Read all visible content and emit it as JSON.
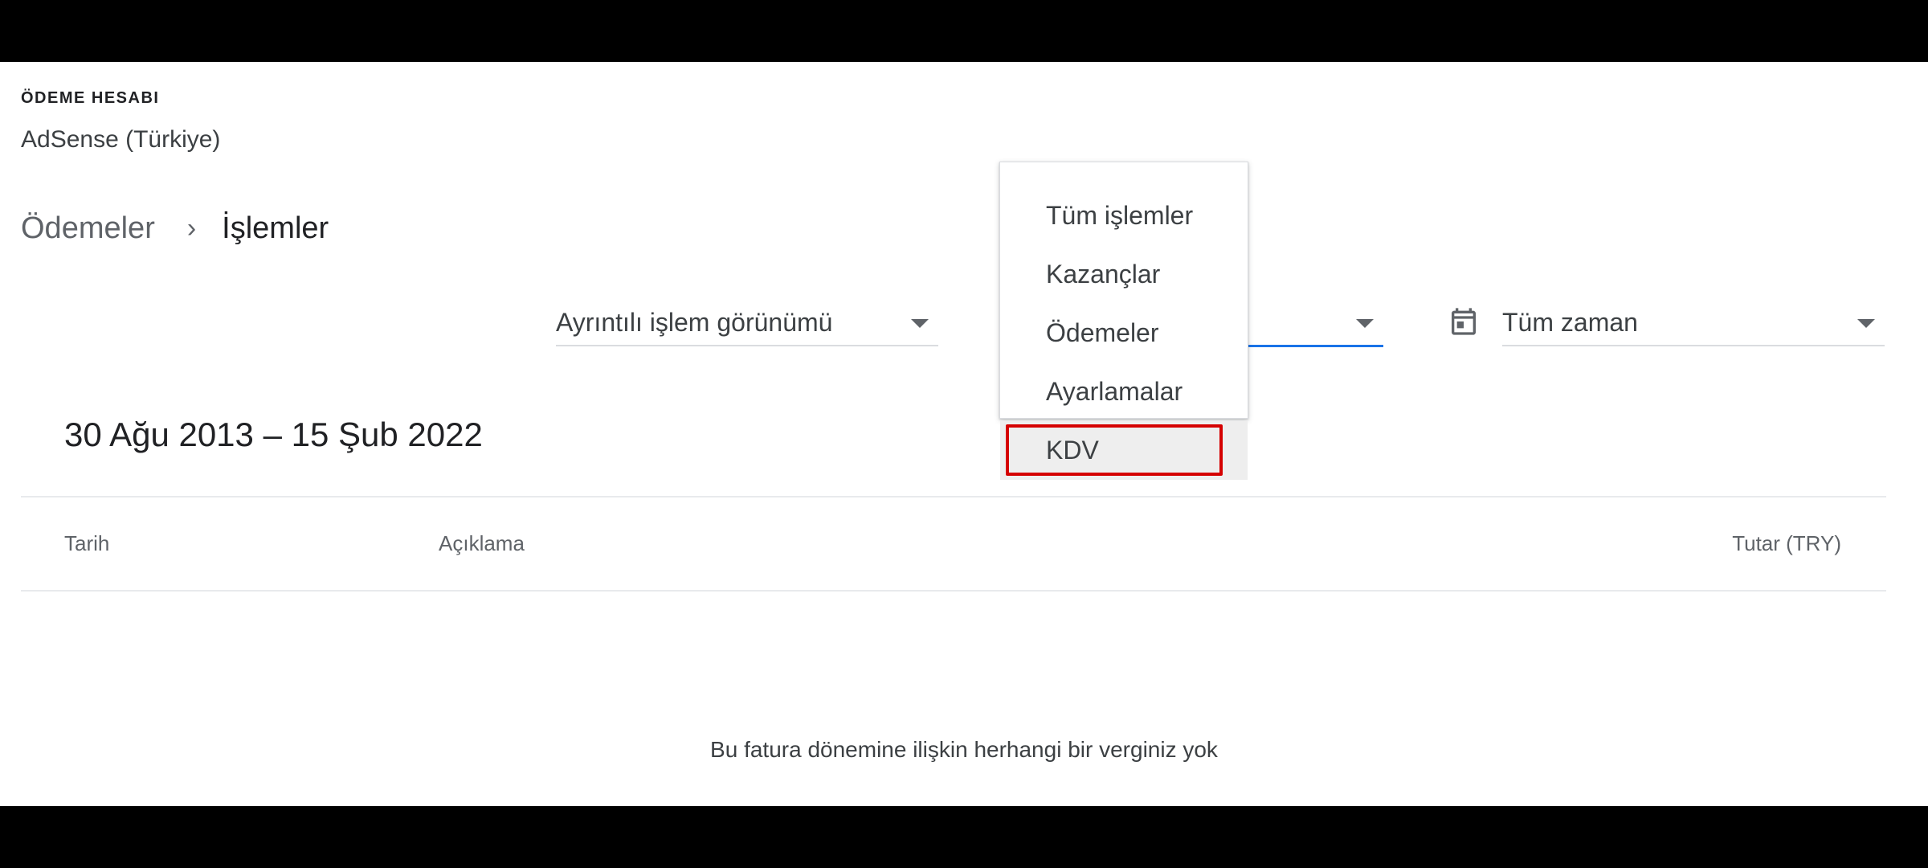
{
  "account": {
    "eyebrow": "ÖDEME HESABI",
    "name": "AdSense (Türkiye)"
  },
  "breadcrumb": {
    "parent": "Ödemeler",
    "separator": "›",
    "current": "İşlemler"
  },
  "filters": {
    "view": {
      "value": "Ayrıntılı işlem görünümü"
    },
    "time": {
      "value": "Tüm zaman",
      "icon": "calendar-icon"
    }
  },
  "dropdown": {
    "items": [
      {
        "label": "Tüm işlemler"
      },
      {
        "label": "Kazançlar"
      },
      {
        "label": "Ödemeler"
      },
      {
        "label": "Ayarlamalar"
      },
      {
        "label": "KDV"
      }
    ],
    "selected": "KDV",
    "highlight_color": "#d50000"
  },
  "range": {
    "title": "30 Ağu 2013 – 15 Şub 2022"
  },
  "table": {
    "columns": [
      "Tarih",
      "Açıklama",
      "Tutar (TRY)"
    ]
  },
  "empty_message": "Bu fatura dönemine ilişkin herhangi bir verginiz yok",
  "colors": {
    "accent": "#1a73e8",
    "highlight": "#d50000"
  }
}
